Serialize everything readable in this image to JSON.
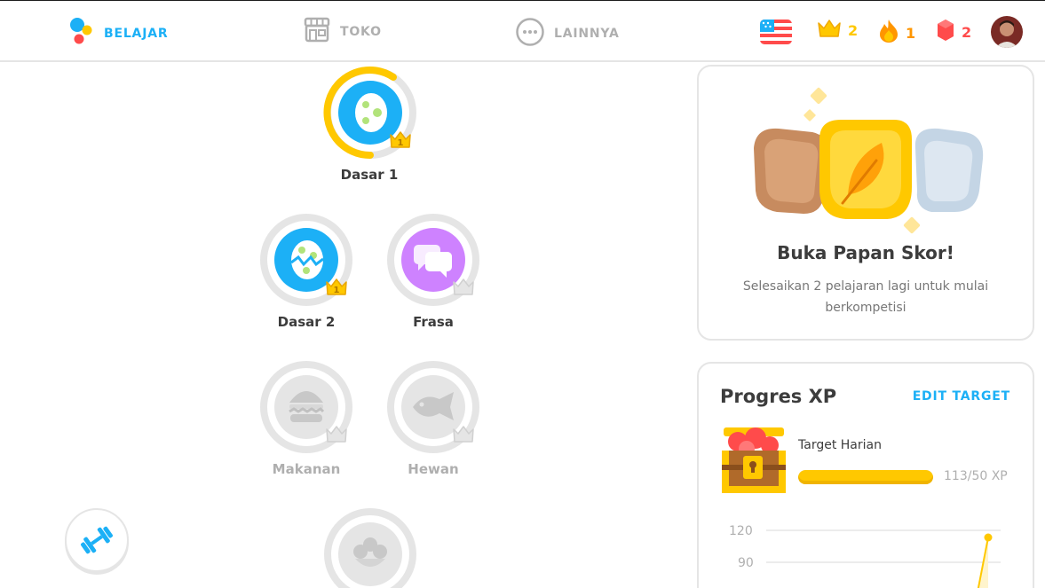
{
  "header": {
    "nav": [
      {
        "label": "BELAJAR",
        "active": true,
        "icon": "duo-dots-icon"
      },
      {
        "label": "TOKO",
        "active": false,
        "icon": "shop-icon"
      },
      {
        "label": "LAINNYA",
        "active": false,
        "icon": "more-icon"
      }
    ],
    "language_flag": "us-flag",
    "crowns": "2",
    "streak": "1",
    "gems": "2",
    "colors": {
      "blue": "#1cb0f6",
      "gold": "#ffc800",
      "orange": "#ff9600",
      "red": "#ff4b4b"
    }
  },
  "skills": [
    {
      "name": "Dasar 1",
      "level": "1",
      "locked": false,
      "icon": "egg-icon",
      "progress": 0.9
    },
    {
      "name": "Dasar 2",
      "level": "1",
      "locked": false,
      "icon": "cracked-egg-icon",
      "progress": 0
    },
    {
      "name": "Frasa",
      "level": "",
      "locked": false,
      "icon": "chat-bubbles-icon",
      "progress": 0
    },
    {
      "name": "Makanan",
      "level": "",
      "locked": true,
      "icon": "burger-icon",
      "progress": 0
    },
    {
      "name": "Hewan",
      "level": "",
      "locked": true,
      "icon": "fish-icon",
      "progress": 0
    },
    {
      "name": "",
      "level": "",
      "locked": true,
      "icon": "flower-icon",
      "progress": 0
    }
  ],
  "practice_icon": "dumbbell-icon",
  "leaderboard": {
    "title": "Buka Papan Skor!",
    "subtitle": "Selesaikan 2 pelajaran lagi untuk mulai berkompetisi"
  },
  "xp": {
    "title": "Progres XP",
    "edit_label": "EDIT TARGET",
    "target_label": "Target Harian",
    "value_text": "113/50 XP",
    "progress": 1.0,
    "chart_ticks": [
      "120",
      "90"
    ]
  }
}
